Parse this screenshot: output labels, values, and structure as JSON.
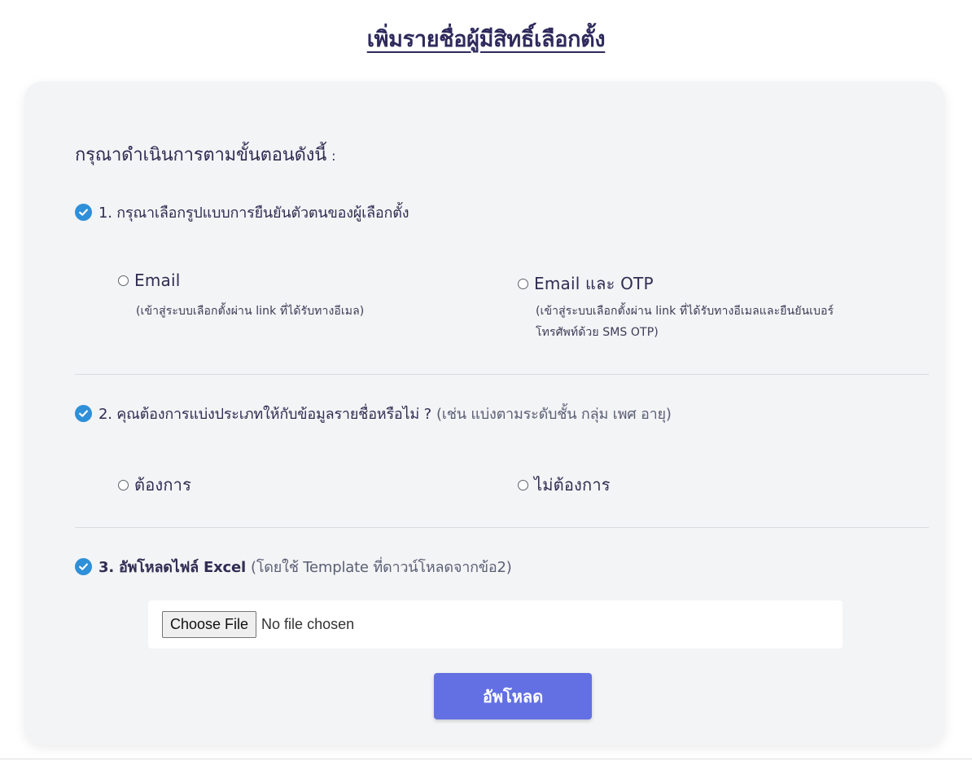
{
  "page": {
    "title": "เพิ่มรายชื่อผู้มีสิทธิ์เลือกตั้ง"
  },
  "instructions": {
    "heading": "กรุณาดำเนินการตามขั้นตอนดังนี้",
    "colon": ":"
  },
  "step1": {
    "label": "1. กรุณาเลือกรูปแบบการยืนยันตัวตนของผู้เลือกตั้ง",
    "options": [
      {
        "label": "Email",
        "description": "(เข้าสู่ระบบเลือกตั้งผ่าน link ที่ได้รับทางอีเมล)",
        "selected": false
      },
      {
        "label": "Email และ OTP",
        "description_line1": "(เข้าสู่ระบบเลือกตั้งผ่าน link ที่ได้รับทางอีเมลและยืนยันเบอร์",
        "description_line2": "โทรศัพท์ด้วย SMS OTP)",
        "selected": false
      }
    ]
  },
  "step2": {
    "label": "2. คุณต้องการแบ่งประเภทให้กับข้อมูลรายชื่อหรือไม่ ?",
    "hint": "(เช่น แบ่งตามระดับชั้น กลุ่ม เพศ อายุ)",
    "options": [
      {
        "label": "ต้องการ",
        "selected": false
      },
      {
        "label": "ไม่ต้องการ",
        "selected": false
      }
    ]
  },
  "step3": {
    "label": "3. อัพโหลดไฟล์ Excel",
    "hint": "(โดยใช้ Template ที่ดาวน์โหลดจากข้อ2)"
  },
  "file_input": {
    "button_label": "Choose File",
    "status": "No file chosen"
  },
  "upload_button": {
    "label": "อัพโหลด"
  },
  "colors": {
    "title": "#2e2a5c",
    "card_background": "#f3f4f6",
    "check_icon": "#2f8fd8",
    "primary_button": "#6270e3"
  },
  "icons": {
    "step_check": "check-circle-icon"
  }
}
